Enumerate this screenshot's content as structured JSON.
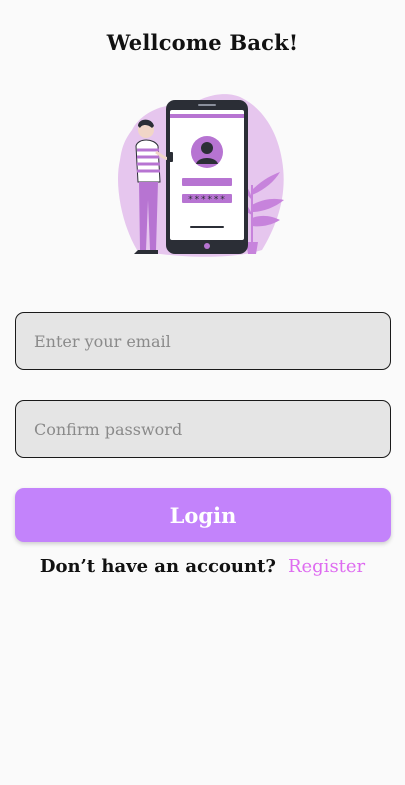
{
  "header": {
    "title": "Wellcome Back!"
  },
  "illustration": {
    "icon": "person-with-phone-login-illustration",
    "password_mask": "******"
  },
  "form": {
    "email_placeholder": "Enter your email",
    "password_placeholder": "Confirm password",
    "login_label": "Login"
  },
  "footer": {
    "question": "Don’t have an account?",
    "register_label": "Register"
  },
  "colors": {
    "accent": "#c383fb",
    "link": "#de6cf0",
    "field_bg": "#e5e5e5",
    "illustration_bg": "#e6c6ee",
    "phone": "#2b2e36"
  }
}
